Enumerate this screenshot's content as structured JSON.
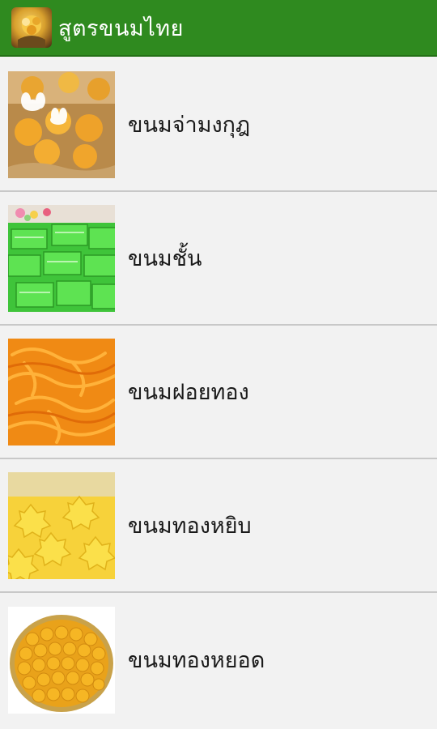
{
  "app_bar": {
    "title": "สูตรขนมไทย",
    "icon": "app-logo-icon",
    "color": "#2f8a1f"
  },
  "items": [
    {
      "label": "ขนมจ่ามงกุฎ",
      "thumbnail": "golden-flower-dessert-image"
    },
    {
      "label": "ขนมชั้น",
      "thumbnail": "green-layer-cake-image"
    },
    {
      "label": "ขนมฝอยทอง",
      "thumbnail": "golden-threads-image"
    },
    {
      "label": "ขนมทองหยิบ",
      "thumbnail": "pinched-gold-image"
    },
    {
      "label": "ขนมทองหยอด",
      "thumbnail": "gold-drops-image"
    }
  ]
}
